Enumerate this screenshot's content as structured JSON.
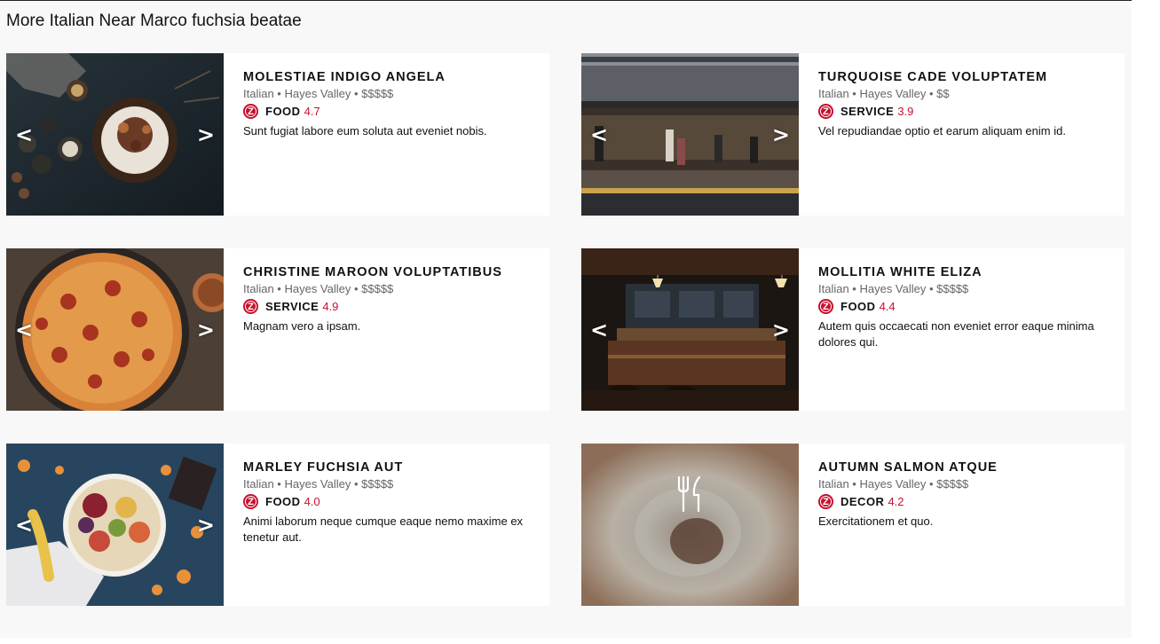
{
  "section": {
    "title": "More Italian Near Marco fuchsia beatae"
  },
  "nav": {
    "prev_glyph": "<",
    "next_glyph": ">"
  },
  "badge_letter": "Z",
  "colors": {
    "accent": "#c8102e",
    "background": "#f8f8f8",
    "card": "#ffffff"
  },
  "restaurants": [
    {
      "name": "MOLESTIAE INDIGO ANGELA",
      "meta": "Italian • Hayes Valley • $$$$$",
      "rating_category": "FOOD",
      "rating_score": "4.7",
      "description": "Sunt fugiat labore eum soluta aut eveniet nobis.",
      "photo": "photo of cake with figs on dark table"
    },
    {
      "name": "TURQUOISE CADE VOLUPTATEM",
      "meta": "Italian • Hayes Valley • $$",
      "rating_category": "SERVICE",
      "rating_score": "3.9",
      "description": "Vel repudiandae optio et earum aliquam enim id.",
      "photo": "photo of cafe terrace with people"
    },
    {
      "name": "CHRISTINE MAROON VOLUPTATIBUS",
      "meta": "Italian • Hayes Valley • $$$$$",
      "rating_category": "SERVICE",
      "rating_score": "4.9",
      "description": "Magnam vero a ipsam.",
      "photo": "photo of pepperoni pizza"
    },
    {
      "name": "MOLLITIA WHITE ELIZA",
      "meta": "Italian • Hayes Valley • $$$$$",
      "rating_category": "FOOD",
      "rating_score": "4.4",
      "description": "Autem quis occaecati non eveniet error eaque minima dolores qui.",
      "photo": "photo of dark bar interior"
    },
    {
      "name": "MARLEY FUCHSIA AUT",
      "meta": "Italian • Hayes Valley • $$$$$",
      "rating_category": "FOOD",
      "rating_score": "4.0",
      "description": "Animi laborum neque cumque eaque nemo maxime ex tenetur aut.",
      "photo": "photo of fruit bowl on blue table"
    },
    {
      "name": "AUTUMN SALMON ATQUE",
      "meta": "Italian • Hayes Valley • $$$$$",
      "rating_category": "DECOR",
      "rating_score": "4.2",
      "description": "Exercitationem et quo.",
      "photo": "placeholder blurred plate with fork-knife icon"
    }
  ]
}
